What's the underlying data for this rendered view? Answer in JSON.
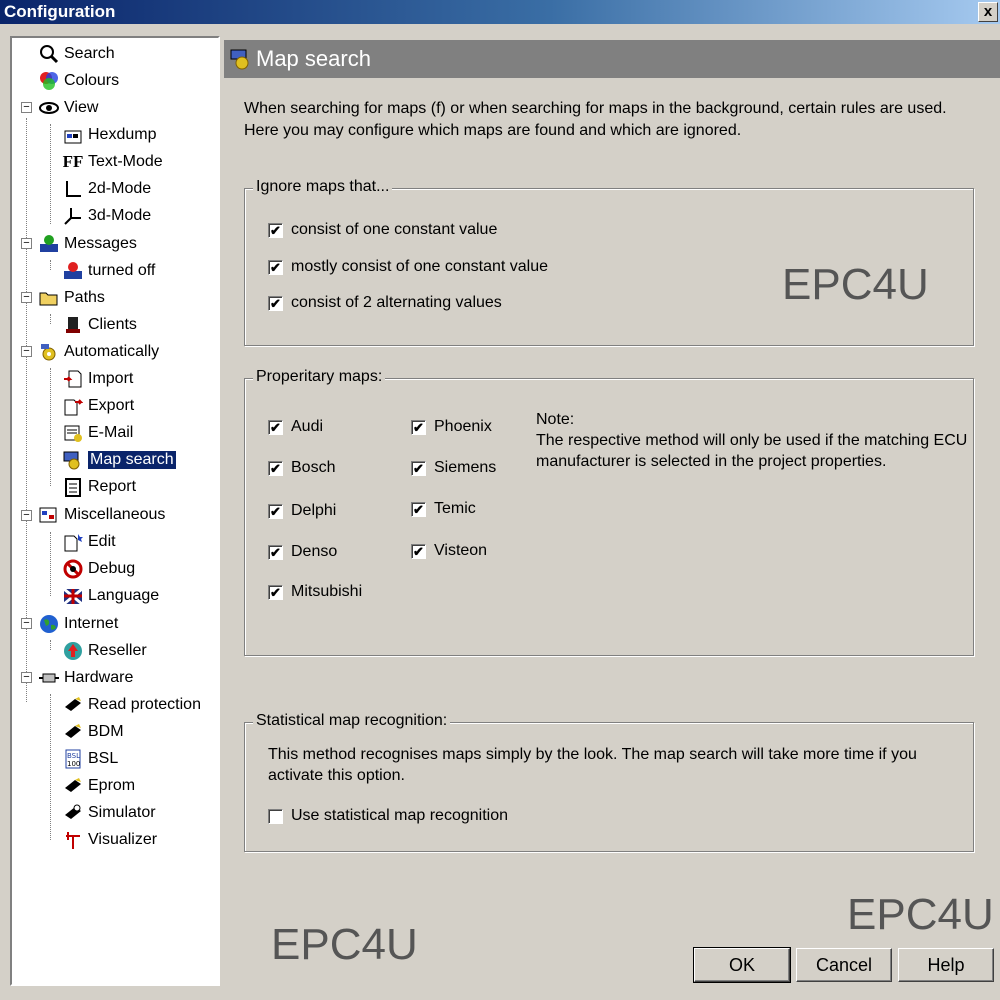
{
  "window": {
    "title": "Configuration",
    "close_label": "x"
  },
  "tree": {
    "items": [
      {
        "label": "Search",
        "icon": "magnifier-icon",
        "level": 0
      },
      {
        "label": "Colours",
        "icon": "colours-icon",
        "level": 0
      },
      {
        "label": "View",
        "icon": "eye-icon",
        "level": 0
      },
      {
        "label": "Hexdump",
        "icon": "hexdump-icon",
        "level": 1
      },
      {
        "label": "Text-Mode",
        "icon": "text-mode-icon",
        "level": 1
      },
      {
        "label": "2d-Mode",
        "icon": "2d-axis-icon",
        "level": 1
      },
      {
        "label": "3d-Mode",
        "icon": "3d-axis-icon",
        "level": 1
      },
      {
        "label": "Messages",
        "icon": "messages-icon",
        "level": 0
      },
      {
        "label": "turned off",
        "icon": "turned-off-icon",
        "level": 1
      },
      {
        "label": "Paths",
        "icon": "folder-icon",
        "level": 0
      },
      {
        "label": "Clients",
        "icon": "clients-icon",
        "level": 1
      },
      {
        "label": "Automatically",
        "icon": "automatically-icon",
        "level": 0
      },
      {
        "label": "Import",
        "icon": "import-icon",
        "level": 1
      },
      {
        "label": "Export",
        "icon": "export-icon",
        "level": 1
      },
      {
        "label": "E-Mail",
        "icon": "email-icon",
        "level": 1
      },
      {
        "label": "Map search",
        "icon": "map-search-icon",
        "level": 1
      },
      {
        "label": "Report",
        "icon": "report-icon",
        "level": 1
      },
      {
        "label": "Miscellaneous",
        "icon": "miscellaneous-icon",
        "level": 0
      },
      {
        "label": "Edit",
        "icon": "edit-icon",
        "level": 1
      },
      {
        "label": "Debug",
        "icon": "debug-icon",
        "level": 1
      },
      {
        "label": "Language",
        "icon": "flag-icon",
        "level": 1
      },
      {
        "label": "Internet",
        "icon": "globe-icon",
        "level": 0
      },
      {
        "label": "Reseller",
        "icon": "reseller-icon",
        "level": 1
      },
      {
        "label": "Hardware",
        "icon": "hardware-icon",
        "level": 0
      },
      {
        "label": "Read protection",
        "icon": "chip-icon",
        "level": 1
      },
      {
        "label": "BDM",
        "icon": "chip-icon",
        "level": 1
      },
      {
        "label": "BSL",
        "icon": "bsl-icon",
        "level": 1
      },
      {
        "label": "Eprom",
        "icon": "chip-icon",
        "level": 1
      },
      {
        "label": "Simulator",
        "icon": "simulator-icon",
        "level": 1
      },
      {
        "label": "Visualizer",
        "icon": "visualizer-icon",
        "level": 1
      }
    ],
    "selected": "Map search"
  },
  "panel": {
    "title": "Map search",
    "intro": "When searching for maps (f) or when searching for maps in the background, certain rules are used. Here you may configure which maps are found and which are ignored.",
    "ignore_group": {
      "title": "Ignore maps that...",
      "options": [
        {
          "label": "consist of one constant value",
          "checked": true
        },
        {
          "label": "mostly consist of one constant value",
          "checked": true
        },
        {
          "label": "consist of 2 alternating values",
          "checked": true
        }
      ]
    },
    "proprietary_group": {
      "title": "Properitary maps:",
      "col1": [
        {
          "label": "Audi",
          "checked": true
        },
        {
          "label": "Bosch",
          "checked": true
        },
        {
          "label": "Delphi",
          "checked": true
        },
        {
          "label": "Denso",
          "checked": true
        },
        {
          "label": "Mitsubishi",
          "checked": true
        }
      ],
      "col2": [
        {
          "label": "Phoenix",
          "checked": true
        },
        {
          "label": "Siemens",
          "checked": true
        },
        {
          "label": "Temic",
          "checked": true
        },
        {
          "label": "Visteon",
          "checked": true
        }
      ],
      "note_title": "Note:",
      "note_line1": "The respective method will only be used if the matching ECU",
      "note_line2": "manufacturer is selected in the project properties."
    },
    "statistical_group": {
      "title": "Statistical map recognition:",
      "description": "This method recognises maps simply by the look. The map search will take more time if you activate this option.",
      "option": {
        "label": "Use statistical map recognition",
        "checked": false
      }
    }
  },
  "watermarks": {
    "brand": "EPC4U"
  },
  "buttons": {
    "ok": "OK",
    "cancel": "Cancel",
    "help": "Help"
  },
  "check_mark": "✔"
}
